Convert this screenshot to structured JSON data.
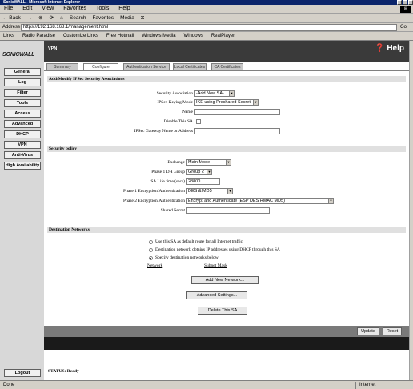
{
  "browser": {
    "window_title": "SonicWALL - Microsoft Internet Explorer",
    "menu": [
      "File",
      "Edit",
      "View",
      "Favorites",
      "Tools",
      "Help"
    ],
    "toolbar": [
      "← Back",
      "→",
      "⊗",
      "⟳",
      "⌂",
      "Search",
      "Favorites",
      "Media",
      "⧖"
    ],
    "address_label": "Address",
    "address_value": "https://192.168.168.1/management.html",
    "go_label": "Go",
    "links_label": "Links",
    "links": [
      "Radio Paradise",
      "Customize Links",
      "Free Hotmail",
      "Windows Media",
      "Windows",
      "RealPlayer"
    ],
    "status_text": "Done",
    "zone_text": "Internet"
  },
  "sidebar": {
    "logo": "SONICWALL",
    "items": [
      "General",
      "Log",
      "Filter",
      "Tools",
      "Access",
      "Advanced",
      "DHCP",
      "VPN",
      "Anti-Virus",
      "High Availability"
    ],
    "logout": "Logout"
  },
  "header": {
    "section": "VPN",
    "help": "❓ Help"
  },
  "tabs": [
    "Summary",
    "Configure",
    "Authentication Service",
    "Local Certificates",
    "CA Certificates"
  ],
  "sa_section": {
    "title": "Add/Modify IPSec Security Associations",
    "security_association_label": "Security Association",
    "security_association_value": "-Add New SA-",
    "keying_mode_label": "IPSec Keying Mode",
    "keying_mode_value": "IKE using Preshared Secret",
    "name_label": "Name",
    "name_value": "",
    "disable_label": "Disable This SA",
    "gateway_label": "IPSec Gateway Name or Address",
    "gateway_value": ""
  },
  "security_policy": {
    "title": "Security policy",
    "exchange_label": "Exchange",
    "exchange_value": "Main Mode",
    "dh_group_label": "Phase 1 DH Group",
    "dh_group_value": "Group 2",
    "sa_life_label": "SA Life time (secs)",
    "sa_life_value": "28800",
    "p1_enc_label": "Phase 1 Encryption/Authentication",
    "p1_enc_value": "DES & MD5",
    "p2_enc_label": "Phase 2 Encryption/Authentication",
    "p2_enc_value": "Encrypt and Authenticate (ESP DES HMAC MD5)",
    "shared_secret_label": "Shared Secret",
    "shared_secret_value": ""
  },
  "destination": {
    "title": "Destination Networks",
    "option1": "Use this SA as default route for all Internet traffic",
    "option2": "Destination network obtains IP addresses using DHCP through this SA",
    "option3": "Specify destination networks below",
    "col_network": "Network",
    "col_subnet": "Subnet Mask",
    "add_network": "Add New Network...",
    "advanced": "Advanced Settings...",
    "delete_sa": "Delete This SA"
  },
  "footer": {
    "update": "Update",
    "reset": "Reset",
    "status": "STATUS: Ready"
  }
}
